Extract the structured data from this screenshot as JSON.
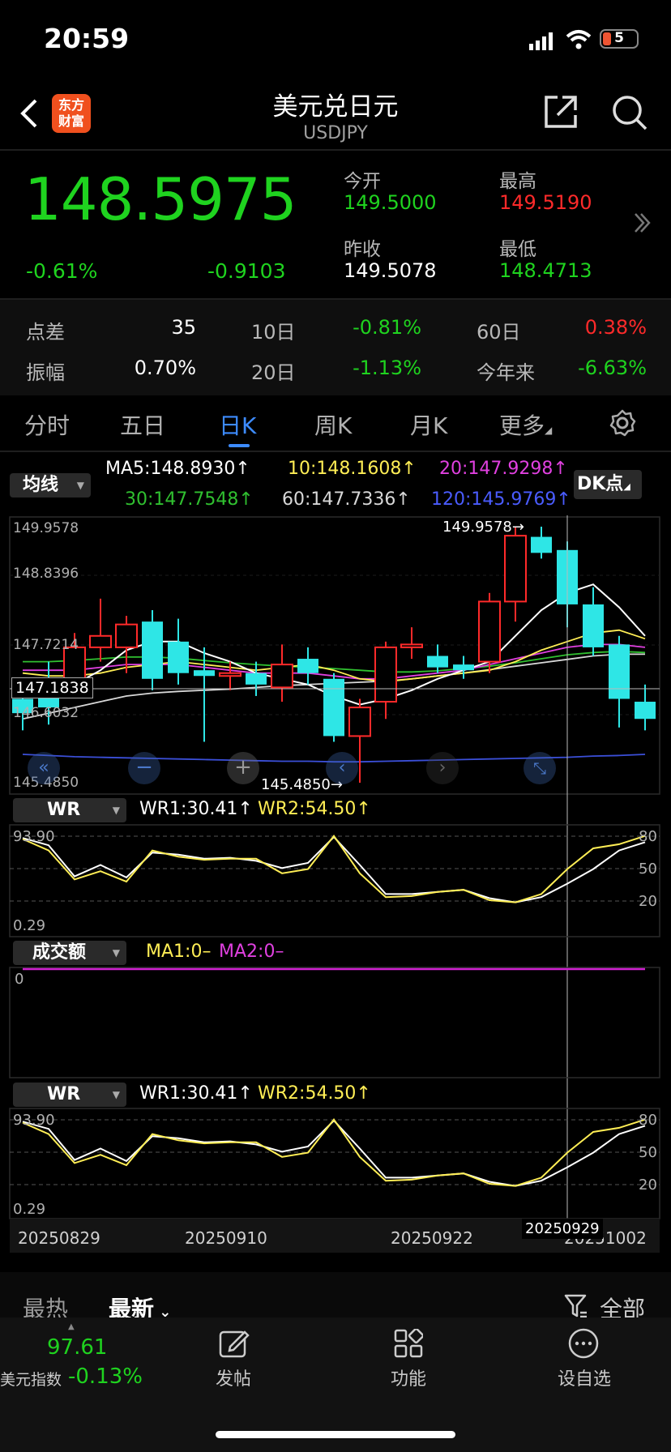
{
  "status_bar": {
    "time": "20:59",
    "battery": "5"
  },
  "header": {
    "title": "美元兑日元",
    "subtitle": "USDJPY",
    "logo_line1": "东方",
    "logo_line2": "财富"
  },
  "quote": {
    "price": "148.5975",
    "change_pct": "-0.61%",
    "change": "-0.9103",
    "open_label": "今开",
    "open": "149.5000",
    "high_label": "最高",
    "high": "149.5190",
    "prev_close_label": "昨收",
    "prev_close": "149.5078",
    "low_label": "最低",
    "low": "148.4713"
  },
  "stats": {
    "spread_label": "点差",
    "spread": "35",
    "d10_label": "10日",
    "d10": "-0.81%",
    "d60_label": "60日",
    "d60": "0.38%",
    "amplitude_label": "振幅",
    "amplitude": "0.70%",
    "d20_label": "20日",
    "d20": "-1.13%",
    "ytd_label": "今年来",
    "ytd": "-6.63%"
  },
  "tabs": [
    "分时",
    "五日",
    "日K",
    "周K",
    "月K",
    "更多"
  ],
  "ma_panel": {
    "selector": "均线",
    "dk_button": "DK点",
    "ma5": "MA5:148.8930",
    "ma10": "10:148.1608",
    "ma20": "20:147.9298",
    "ma30": "30:147.7548",
    "ma60": "60:147.7336",
    "ma120": "120:145.9769",
    "arrow": "↑"
  },
  "colors": {
    "up": "#ff2a2a",
    "down": "#2ee6e6",
    "ma5": "#ffffff",
    "ma10": "#ffee55",
    "ma20": "#e040e0",
    "ma30": "#30c030",
    "ma60": "#d8d8d8",
    "ma120": "#3b4fd8"
  },
  "price_axis": [
    "149.9578",
    "148.8396",
    "147.7214",
    "146.6032",
    "145.4850"
  ],
  "crosshair_price": "147.1838",
  "max_label": "149.9578→",
  "min_label": "145.4850→",
  "wr_panel": {
    "selector": "WR",
    "wr1": "WR1:30.41",
    "wr2": "WR2:54.50",
    "arrow": "↑",
    "top": "93.90",
    "bottom": "0.29",
    "levels": [
      "80",
      "50",
      "20"
    ]
  },
  "volume_panel": {
    "selector": "成交额",
    "ma1": "MA1:0–",
    "ma2": "MA2:0–",
    "zero": "0"
  },
  "dates": [
    "20250829",
    "20250910",
    "20250922",
    "20251002"
  ],
  "crosshair_date": "20250929",
  "feed": {
    "hot": "最热",
    "latest": "最新",
    "filter": "全部"
  },
  "bottom_nav": {
    "index_value": "97.61",
    "index_name": "美元指数",
    "index_change": "-0.13%",
    "post": "发帖",
    "function": "功能",
    "watchlist": "设自选"
  },
  "chart_data": {
    "type": "candlestick",
    "title": "USDJPY 日K",
    "ylim": [
      145.485,
      149.9578
    ],
    "candles": [
      {
        "open": 146.95,
        "close": 146.7,
        "high": 147.3,
        "low": 146.4
      },
      {
        "open": 147.0,
        "close": 146.8,
        "high": 147.6,
        "low": 146.5
      },
      {
        "open": 147.3,
        "close": 147.85,
        "high": 148.1,
        "low": 147.1
      },
      {
        "open": 147.85,
        "close": 148.05,
        "high": 148.7,
        "low": 147.6
      },
      {
        "open": 147.85,
        "close": 148.25,
        "high": 148.4,
        "low": 147.4
      },
      {
        "open": 148.3,
        "close": 147.3,
        "high": 148.5,
        "low": 147.1
      },
      {
        "open": 147.95,
        "close": 147.4,
        "high": 148.35,
        "low": 147.2
      },
      {
        "open": 147.45,
        "close": 147.35,
        "high": 147.85,
        "low": 146.2
      },
      {
        "open": 147.35,
        "close": 147.4,
        "high": 147.6,
        "low": 147.1
      },
      {
        "open": 147.4,
        "close": 147.2,
        "high": 147.6,
        "low": 147.0
      },
      {
        "open": 147.15,
        "close": 147.55,
        "high": 147.9,
        "low": 146.9
      },
      {
        "open": 147.65,
        "close": 147.4,
        "high": 147.85,
        "low": 147.2
      },
      {
        "open": 147.3,
        "close": 146.3,
        "high": 147.4,
        "low": 146.2
      },
      {
        "open": 146.3,
        "close": 146.8,
        "high": 146.95,
        "low": 145.485
      },
      {
        "open": 146.9,
        "close": 147.85,
        "high": 147.95,
        "low": 146.6
      },
      {
        "open": 147.85,
        "close": 147.9,
        "high": 148.2,
        "low": 147.65
      },
      {
        "open": 147.7,
        "close": 147.5,
        "high": 147.9,
        "low": 147.4
      },
      {
        "open": 147.55,
        "close": 147.45,
        "high": 147.7,
        "low": 147.3
      },
      {
        "open": 147.6,
        "close": 148.65,
        "high": 148.8,
        "low": 147.4
      },
      {
        "open": 148.65,
        "close": 149.8,
        "high": 149.9578,
        "low": 148.3
      },
      {
        "open": 149.78,
        "close": 149.5,
        "high": 149.9578,
        "low": 149.4
      },
      {
        "open": 149.55,
        "close": 148.6,
        "high": 149.7,
        "low": 148.2
      },
      {
        "open": 148.6,
        "close": 147.85,
        "high": 148.9,
        "low": 147.7
      },
      {
        "open": 147.9,
        "close": 146.95,
        "high": 148.05,
        "low": 146.45
      },
      {
        "open": 146.9,
        "close": 146.6,
        "high": 147.2,
        "low": 146.4
      }
    ],
    "ma_series": {
      "ma5": [
        147.2,
        147.1,
        147.2,
        147.45,
        147.8,
        147.95,
        147.95,
        147.75,
        147.6,
        147.4,
        147.3,
        147.2,
        147.0,
        146.85,
        146.95,
        147.1,
        147.3,
        147.45,
        147.6,
        148.05,
        148.5,
        148.8,
        148.95,
        148.55,
        148.05
      ],
      "ma10": [
        147.4,
        147.35,
        147.35,
        147.4,
        147.5,
        147.55,
        147.6,
        147.55,
        147.5,
        147.45,
        147.5,
        147.55,
        147.45,
        147.3,
        147.25,
        147.3,
        147.35,
        147.4,
        147.45,
        147.6,
        147.8,
        147.95,
        148.1,
        148.15,
        148.0
      ],
      "ma20": [
        147.45,
        147.45,
        147.45,
        147.5,
        147.55,
        147.55,
        147.55,
        147.5,
        147.45,
        147.4,
        147.4,
        147.4,
        147.35,
        147.3,
        147.3,
        147.35,
        147.4,
        147.45,
        147.55,
        147.65,
        147.75,
        147.85,
        147.9,
        147.9,
        147.85
      ],
      "ma30": [
        147.6,
        147.6,
        147.62,
        147.65,
        147.68,
        147.68,
        147.66,
        147.62,
        147.58,
        147.55,
        147.52,
        147.5,
        147.48,
        147.45,
        147.42,
        147.42,
        147.44,
        147.48,
        147.52,
        147.58,
        147.65,
        147.72,
        147.76,
        147.78,
        147.76
      ],
      "ma60": [
        146.6,
        146.7,
        146.8,
        146.9,
        147.0,
        147.05,
        147.08,
        147.1,
        147.12,
        147.15,
        147.18,
        147.2,
        147.22,
        147.24,
        147.26,
        147.3,
        147.35,
        147.4,
        147.46,
        147.52,
        147.58,
        147.64,
        147.7,
        147.73,
        147.73
      ],
      "ma120": [
        145.98,
        145.96,
        145.94,
        145.93,
        145.92,
        145.91,
        145.9,
        145.89,
        145.88,
        145.87,
        145.86,
        145.86,
        145.85,
        145.85,
        145.86,
        145.87,
        145.88,
        145.89,
        145.9,
        145.91,
        145.92,
        145.93,
        145.95,
        145.96,
        145.98
      ]
    },
    "wr1": [
      92,
      85,
      55,
      66,
      54,
      78,
      76,
      72,
      73,
      70,
      63,
      68,
      93,
      66,
      38,
      38,
      40,
      42,
      34,
      30,
      35,
      48,
      62,
      80,
      88
    ],
    "wr2": [
      91,
      80,
      52,
      60,
      50,
      80,
      74,
      71,
      72,
      72,
      58,
      62,
      94,
      58,
      35,
      36,
      40,
      42,
      32,
      30,
      38,
      62,
      82,
      86,
      94
    ]
  }
}
